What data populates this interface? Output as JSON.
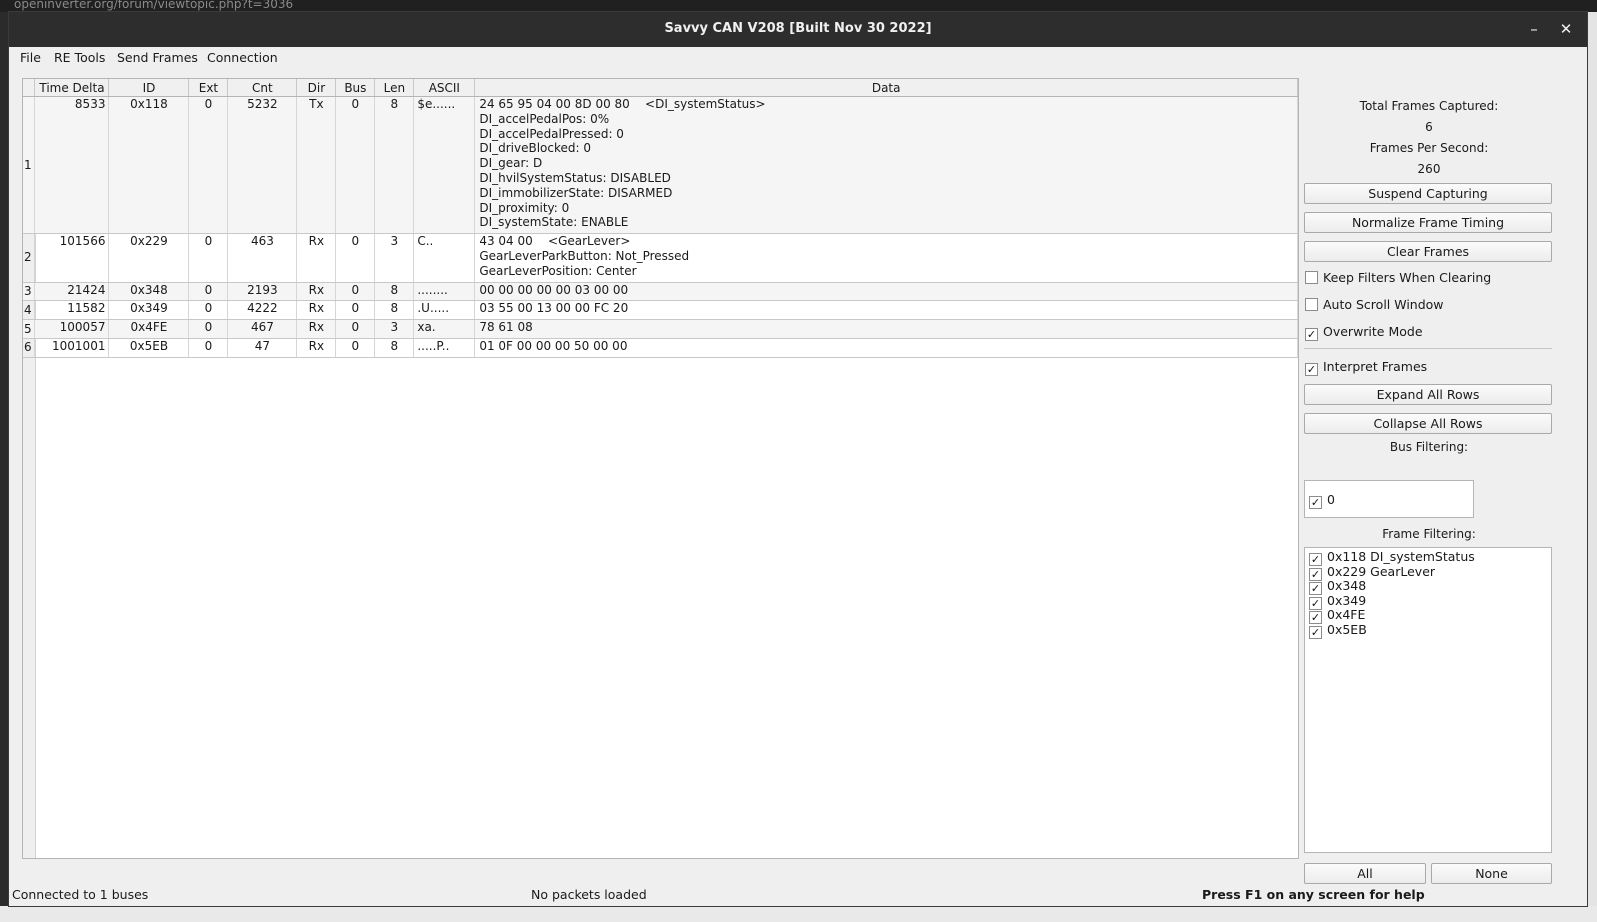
{
  "background": {
    "browser_url": "openinverter.org/forum/viewtopic.php?t=3036"
  },
  "window": {
    "title": "Savvy CAN V208 [Built Nov 30 2022]",
    "minimize_glyph": "–",
    "close_glyph": "✕"
  },
  "menu": {
    "items": [
      "File",
      "RE Tools",
      "Send Frames",
      "Connection"
    ]
  },
  "table": {
    "columns": [
      "Time Delta",
      "ID",
      "Ext",
      "Cnt",
      "Dir",
      "Bus",
      "Len",
      "ASCII",
      "Data"
    ],
    "rows": [
      {
        "index": "1",
        "time_delta": "8533",
        "id": "0x118",
        "ext": "0",
        "cnt": "5232",
        "dir": "Tx",
        "bus": "0",
        "len": "8",
        "ascii": "$e......",
        "data": [
          "24 65 95 04 00 8D 00 80    <DI_systemStatus>",
          "DI_accelPedalPos: 0%",
          "DI_accelPedalPressed: 0",
          "DI_driveBlocked: 0",
          "DI_gear: D",
          "DI_hvilSystemStatus: DISABLED",
          "DI_immobilizerState: DISARMED",
          "DI_proximity: 0",
          "DI_systemState: ENABLE"
        ]
      },
      {
        "index": "2",
        "time_delta": "101566",
        "id": "0x229",
        "ext": "0",
        "cnt": "463",
        "dir": "Rx",
        "bus": "0",
        "len": "3",
        "ascii": "C..",
        "data": [
          "43 04 00    <GearLever>",
          "GearLeverParkButton: Not_Pressed",
          "GearLeverPosition: Center"
        ]
      },
      {
        "index": "3",
        "time_delta": "21424",
        "id": "0x348",
        "ext": "0",
        "cnt": "2193",
        "dir": "Rx",
        "bus": "0",
        "len": "8",
        "ascii": "........",
        "data": [
          "00 00 00 00 00 03 00 00"
        ]
      },
      {
        "index": "4",
        "time_delta": "11582",
        "id": "0x349",
        "ext": "0",
        "cnt": "4222",
        "dir": "Rx",
        "bus": "0",
        "len": "8",
        "ascii": ".U.....",
        "data": [
          "03 55 00 13 00 00 FC 20"
        ]
      },
      {
        "index": "5",
        "time_delta": "100057",
        "id": "0x4FE",
        "ext": "0",
        "cnt": "467",
        "dir": "Rx",
        "bus": "0",
        "len": "3",
        "ascii": "xa.",
        "data": [
          "78 61 08"
        ]
      },
      {
        "index": "6",
        "time_delta": "1001001",
        "id": "0x5EB",
        "ext": "0",
        "cnt": "47",
        "dir": "Rx",
        "bus": "0",
        "len": "8",
        "ascii": ".....P..",
        "data": [
          "01 0F 00 00 00 50 00 00"
        ]
      }
    ]
  },
  "panel": {
    "total_frames_label": "Total Frames Captured:",
    "total_frames_value": "6",
    "fps_label": "Frames Per Second:",
    "fps_value": "260",
    "suspend_button": "Suspend Capturing",
    "normalize_button": "Normalize Frame Timing",
    "clear_button": "Clear Frames",
    "keep_filters": {
      "label": "Keep Filters When Clearing",
      "checked": false
    },
    "auto_scroll": {
      "label": "Auto Scroll Window",
      "checked": false
    },
    "overwrite_mode": {
      "label": "Overwrite Mode",
      "checked": true
    },
    "interpret_frames": {
      "label": "Interpret Frames",
      "checked": true
    },
    "expand_button": "Expand All Rows",
    "collapse_button": "Collapse All Rows",
    "bus_filter_label": "Bus Filtering:",
    "bus_filters": [
      {
        "label": "0",
        "checked": true
      }
    ],
    "frame_filter_label": "Frame Filtering:",
    "frame_filters": [
      {
        "label": "0x118 DI_systemStatus",
        "checked": true
      },
      {
        "label": "0x229 GearLever",
        "checked": true
      },
      {
        "label": "0x348",
        "checked": true
      },
      {
        "label": "0x349",
        "checked": true
      },
      {
        "label": "0x4FE",
        "checked": true
      },
      {
        "label": "0x5EB",
        "checked": true
      }
    ],
    "all_button": "All",
    "none_button": "None"
  },
  "status": {
    "left": "Connected to 1 buses",
    "center": "No packets loaded",
    "right": "Press F1 on any screen for help"
  }
}
